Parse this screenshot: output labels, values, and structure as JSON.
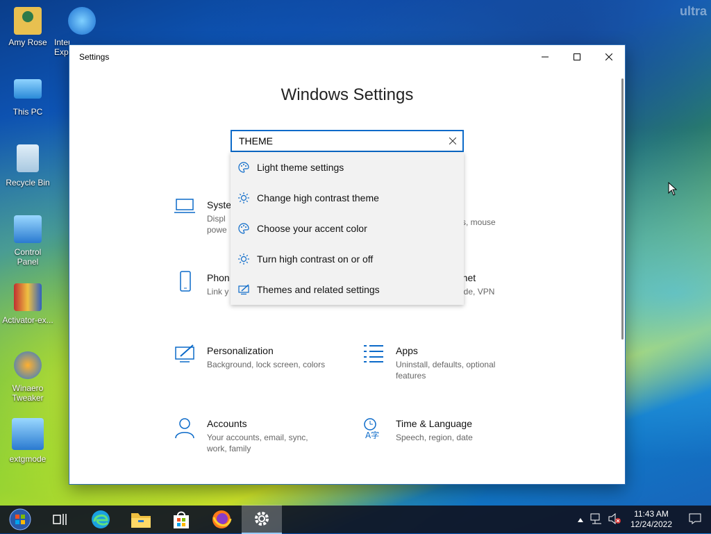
{
  "desktop": {
    "watermark": "ultra",
    "icons": [
      {
        "label": "Amy Rose"
      },
      {
        "label": "Internet Explorer"
      },
      {
        "label": "This PC"
      },
      {
        "label": "Recycle Bin"
      },
      {
        "label": "Control Panel"
      },
      {
        "label": "Activator-ex..."
      },
      {
        "label": "Winaero Tweaker"
      },
      {
        "label": "extgmode"
      }
    ]
  },
  "window": {
    "title": "Settings",
    "heading": "Windows Settings",
    "search": {
      "value": "THEME"
    },
    "suggestions": [
      {
        "label": "Light theme settings",
        "icon": "palette-icon"
      },
      {
        "label": "Change high contrast theme",
        "icon": "sun-icon"
      },
      {
        "label": "Choose your accent color",
        "icon": "palette-icon"
      },
      {
        "label": "Turn high contrast on or off",
        "icon": "sun-icon"
      },
      {
        "label": "Themes and related settings",
        "icon": "brush-monitor-icon"
      }
    ],
    "tiles": [
      {
        "name": "Syste",
        "desc": "Displ\npowe"
      },
      {
        "name": "",
        "desc": "rs, mouse"
      },
      {
        "name": "Phon",
        "desc": "Link y"
      },
      {
        "name": "rnet",
        "desc": "ode, VPN"
      },
      {
        "name": "Personalization",
        "desc": "Background, lock screen, colors"
      },
      {
        "name": "Apps",
        "desc": "Uninstall, defaults, optional features"
      },
      {
        "name": "Accounts",
        "desc": "Your accounts, email, sync, work, family"
      },
      {
        "name": "Time & Language",
        "desc": "Speech, region, date"
      }
    ]
  },
  "taskbar": {
    "time": "11:43 AM",
    "date": "12/24/2022"
  }
}
